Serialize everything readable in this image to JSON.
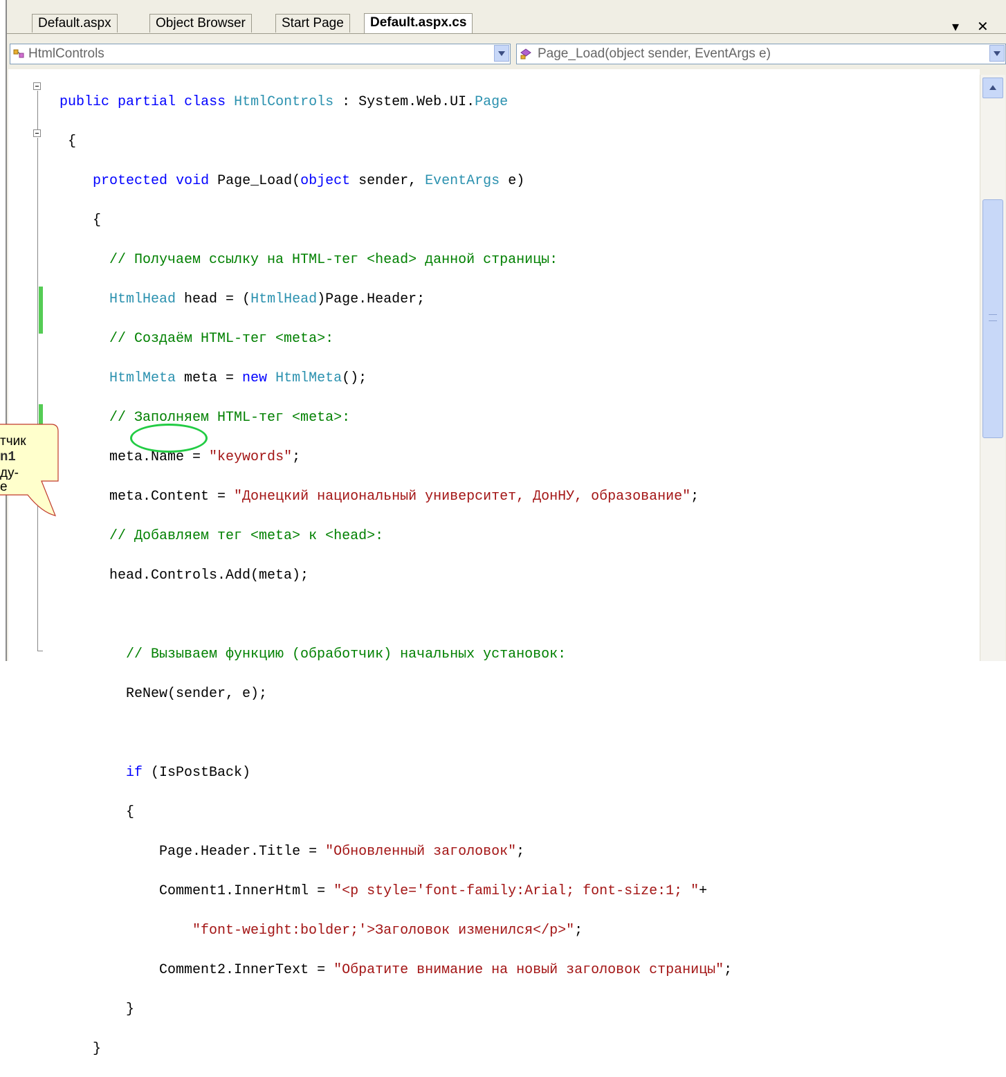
{
  "tabs": [
    {
      "label": "Default.aspx",
      "active": false
    },
    {
      "label": "Object Browser",
      "active": false
    },
    {
      "label": "Start Page",
      "active": false
    },
    {
      "label": "Default.aspx.cs",
      "active": true
    }
  ],
  "tab_controls": {
    "dropdown": "▾",
    "close": "✕"
  },
  "navbar": {
    "class_combo": "HtmlControls",
    "member_combo": "Page_Load(object sender, EventArgs e)"
  },
  "code": {
    "l1": {
      "kw1": "public",
      "kw2": "partial",
      "kw3": "class",
      "name": "HtmlControls",
      "sep": " : ",
      "ns": "System.Web.UI.",
      "base": "Page"
    },
    "l2": "{",
    "l3": {
      "kw1": "protected",
      "kw2": "void",
      "name": " Page_Load(",
      "kw3": "object",
      "mid": " sender, ",
      "ty": "EventArgs",
      "end": " e)"
    },
    "l4": "{",
    "l5": "// Получаем ссылку на HTML-тег <head> данной страницы:",
    "l6": {
      "ty1": "HtmlHead",
      "mid": " head = (",
      "ty2": "HtmlHead",
      "end": ")Page.Header;"
    },
    "l7": "// Создаём HTML-тег <meta>:",
    "l8": {
      "ty1": "HtmlMeta",
      "mid": " meta = ",
      "kw": "new",
      "ty2": "HtmlMeta",
      "end": "();"
    },
    "l9": "// Заполняем HTML-тег <meta>:",
    "l10": {
      "pre": "meta.Name = ",
      "str": "\"keywords\"",
      "end": ";"
    },
    "l11": {
      "pre": "meta.Content = ",
      "str": "\"Донецкий национальный университет, ДонНУ, образование\"",
      "end": ";"
    },
    "l12": "// Добавляем тег <meta> к <head>:",
    "l13": "head.Controls.Add(meta);",
    "l15": "// Вызываем функцию (обработчик) начальных установок:",
    "l16": "ReNew(sender, e);",
    "l18": {
      "kw": "if",
      "end": " (IsPostBack)"
    },
    "l19": "{",
    "l20": {
      "pre": "Page.Header.Title = ",
      "str": "\"Обновленный заголовок\"",
      "end": ";"
    },
    "l21": {
      "pre": "Comment1.InnerHtml = ",
      "str": "\"<p style='font-family:Arial; font-size:1; \"",
      "end": "+"
    },
    "l22": {
      "str": "\"font-weight:bolder;'>Заголовок изменился</p>\"",
      "end": ";"
    },
    "l23": {
      "pre": "Comment2.InnerText = ",
      "str": "\"Обратите внимание на новый заголовок страницы\"",
      "end": ";"
    },
    "l24": "}",
    "l25": "}"
  },
  "callout": {
    "line1": "тчик",
    "line2": "n1",
    "line3": "ду-",
    "line4": "е"
  },
  "colors": {
    "keyword": "#0000ff",
    "type": "#2b91af",
    "comment": "#008000",
    "string": "#a31515",
    "highlight_ellipse": "#22cc44"
  }
}
